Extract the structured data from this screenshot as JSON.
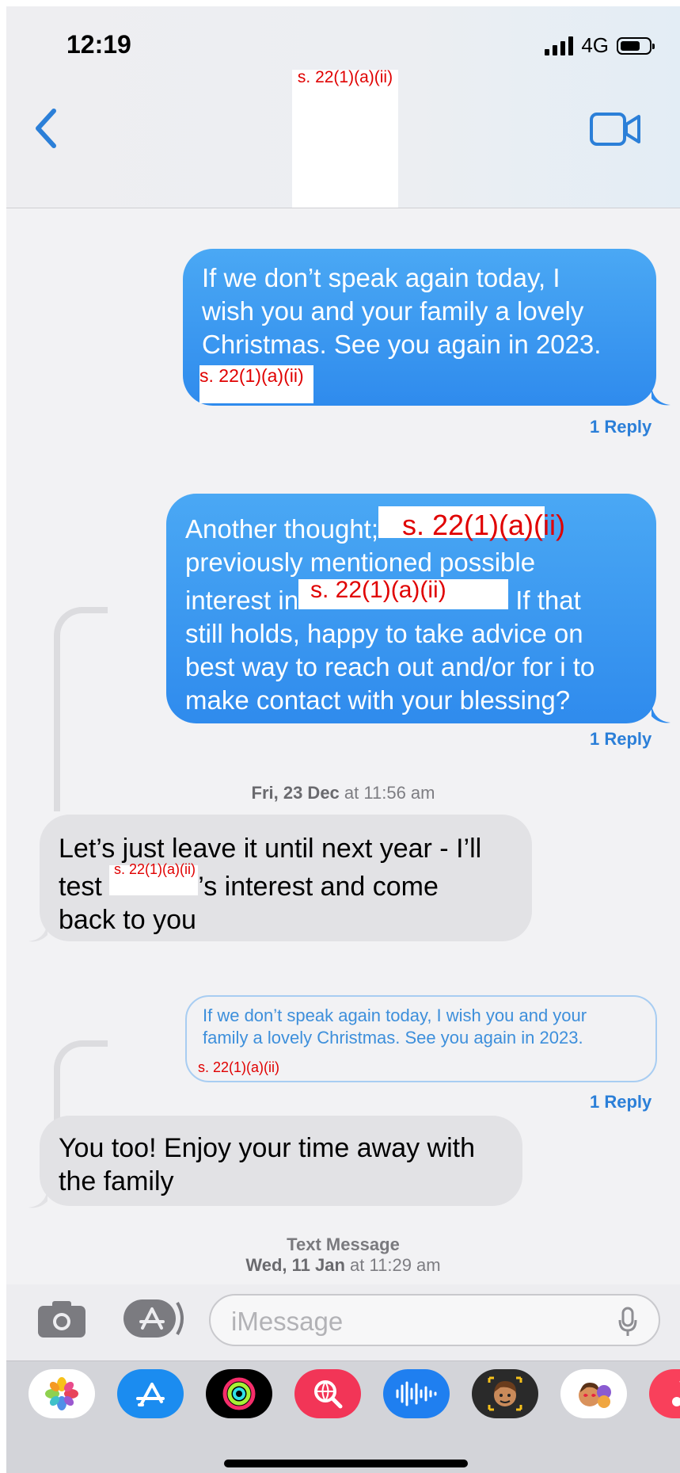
{
  "status": {
    "time": "12:19",
    "network": "4G"
  },
  "header": {
    "contact_redaction": "s. 22(1)(a)(ii)"
  },
  "messages": [
    {
      "direction": "outgoing",
      "text": "If we don’t speak again today, I wish you and your family a lovely Christmas. See you again in 2023.",
      "line1": "If we don’t speak again today, I",
      "line2": "wish you and your family a lovely",
      "line3": "Christmas. See you again in 2023.",
      "redaction": "s. 22(1)(a)(ii)",
      "reply_label": "1 Reply"
    },
    {
      "direction": "outgoing",
      "line1_a": "Another thought;",
      "redaction_1": "s. 22(1)(a)(ii)",
      "line2": "previously mentioned possible",
      "line3_a": "interest in",
      "redaction_2": "s. 22(1)(a)(ii)",
      "line3_b": "If that",
      "line4": "still holds, happy to take advice on",
      "line5": "best way to reach out and/or for i to",
      "line6": "make contact with your blessing?",
      "reply_label": "1 Reply"
    },
    {
      "timestamp_day": "Fri, 23 Dec",
      "timestamp_time": "at 11:56 am"
    },
    {
      "direction": "incoming",
      "line1": "Let’s just leave it until next year - I’ll",
      "line2_a": "test",
      "redaction": "s. 22(1)(a)(ii)",
      "line2_b": "’s interest and come",
      "line3": "back to you"
    },
    {
      "direction": "quoted",
      "line1": "If we don’t speak again today, I wish you and your",
      "line2": "family a lovely Christmas. See you again in 2023.",
      "redaction": "s. 22(1)(a)(ii)",
      "reply_label": "1 Reply"
    },
    {
      "direction": "incoming",
      "line1": "You too! Enjoy your time away with",
      "line2": "the family"
    },
    {
      "service_label": "Text Message",
      "timestamp_day": "Wed, 11 Jan",
      "timestamp_time": "at 11:29 am"
    }
  ],
  "composer": {
    "placeholder": "iMessage"
  },
  "drawer_apps": [
    "photos-app",
    "app-store-app",
    "fitness-app",
    "search-images-app",
    "audio-app",
    "memoji-app",
    "stickers-app",
    "music-app"
  ],
  "colors": {
    "outgoing_bubble": "#2f8bed",
    "incoming_bubble": "#e2e2e5",
    "accent": "#2b7fd8",
    "redaction_text": "#e00000"
  }
}
